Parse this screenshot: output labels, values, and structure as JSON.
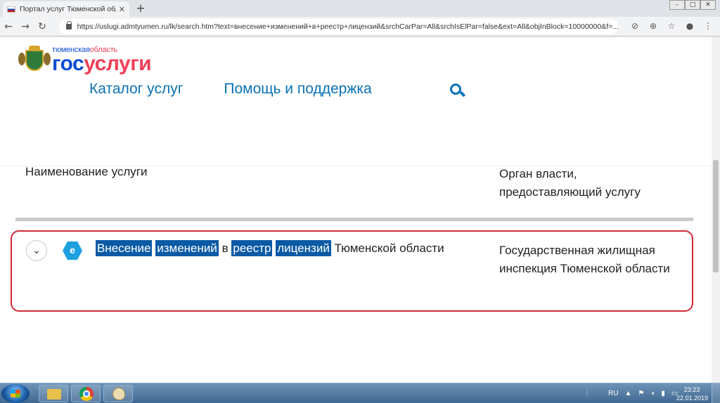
{
  "browser": {
    "tab_title": "Портал услуг Тюменской облас",
    "tab_close": "✕",
    "new_tab": "+",
    "url": "https://uslugi.admtyumen.ru/lk/search.htm?text=внесение+изменений+в+реестр+лицензий&srchCarPar=All&srchIsElPar=false&ext=All&objInBlock=10000000&f=..."
  },
  "site": {
    "region_prefix": "тюменская",
    "region_suffix": "область",
    "brand_gos": "гос",
    "brand_uslugi": "услуги",
    "nav": {
      "catalog": "Каталог услуг",
      "help": "Помощь и поддержка"
    }
  },
  "results": {
    "col_service": "Наименование услуги",
    "col_agency": "Орган власти, предоставляющий услугу",
    "rows": [
      {
        "badge": "е",
        "name_words": [
          "Внесение",
          "изменений",
          "в",
          "реестр",
          "лицензий",
          "Тюменской области"
        ],
        "agency": "Государственная жилищная инспекция Тюменской области"
      }
    ]
  },
  "taskbar": {
    "lang": "RU",
    "time": "23:23",
    "date": "22.01.2019"
  },
  "colors": {
    "brand_blue": "#0d4cd3",
    "brand_red": "#ee3f58",
    "link_blue": "#0b72b5",
    "highlight": "#0a5aa5",
    "outline_red": "#d42a35"
  }
}
